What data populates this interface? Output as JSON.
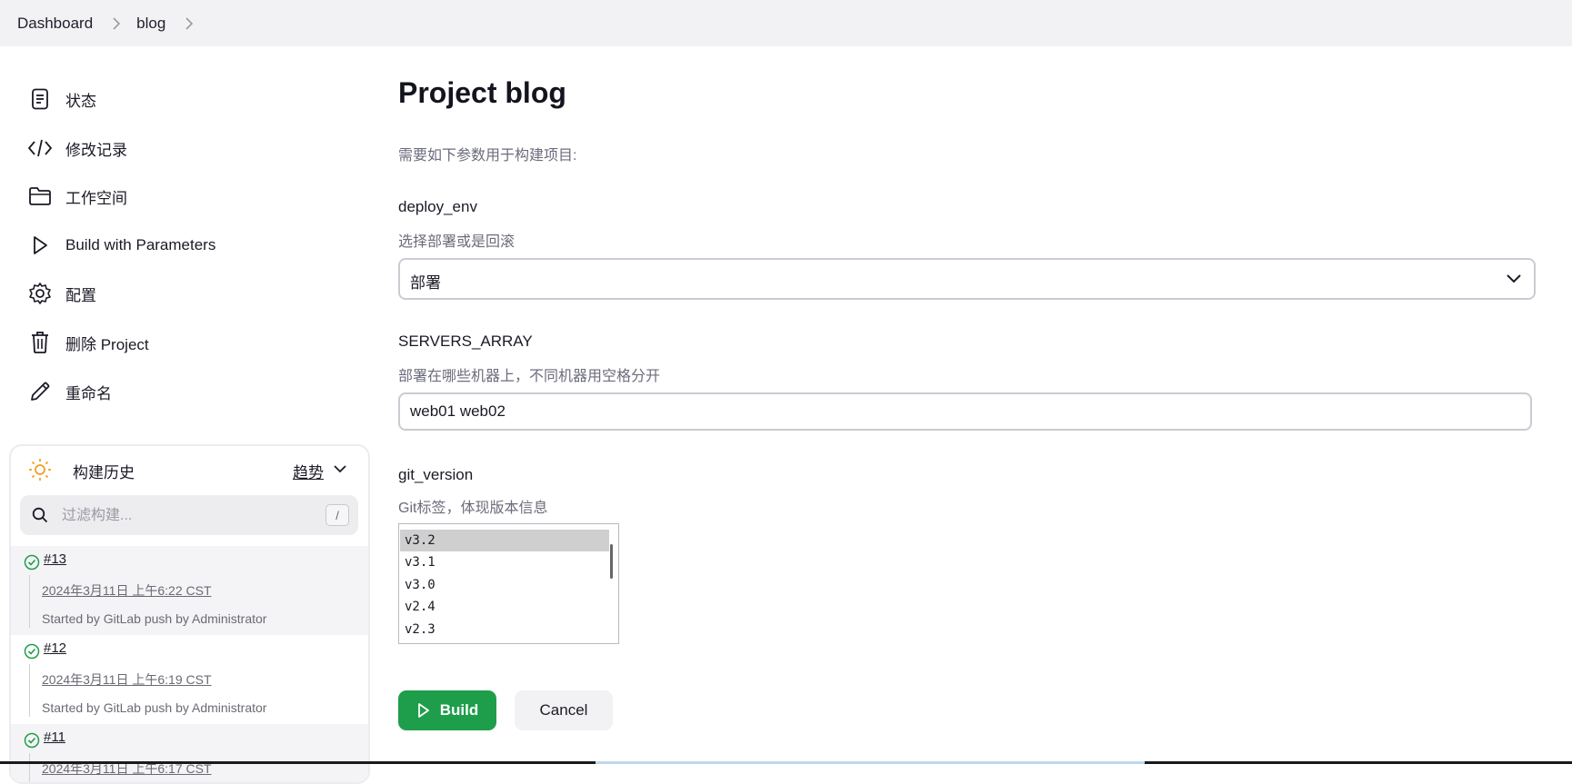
{
  "breadcrumb": {
    "items": [
      "Dashboard",
      "blog"
    ]
  },
  "sidebar": {
    "items": [
      {
        "label": "状态",
        "icon": "status-icon"
      },
      {
        "label": "修改记录",
        "icon": "code-icon"
      },
      {
        "label": "工作空间",
        "icon": "folder-icon"
      },
      {
        "label": "Build with Parameters",
        "icon": "play-icon"
      },
      {
        "label": "配置",
        "icon": "gear-icon"
      },
      {
        "label": "删除 Project",
        "icon": "trash-icon"
      },
      {
        "label": "重命名",
        "icon": "pencil-icon"
      }
    ]
  },
  "history": {
    "title": "构建历史",
    "trend_label": "趋势",
    "search_placeholder": "过滤构建...",
    "shortcut": "/",
    "builds": [
      {
        "number": "#13",
        "date": "2024年3月11日 上午6:22 CST",
        "cause": "Started by GitLab push by Administrator",
        "status": "success"
      },
      {
        "number": "#12",
        "date": "2024年3月11日 上午6:19 CST",
        "cause": "Started by GitLab push by Administrator",
        "status": "success"
      },
      {
        "number": "#11",
        "date": "2024年3月11日 上午6:17 CST",
        "cause": "",
        "status": "success"
      }
    ]
  },
  "main": {
    "title": "Project blog",
    "intro": "需要如下参数用于构建项目:",
    "params": {
      "deploy_env": {
        "name": "deploy_env",
        "description": "选择部署或是回滚",
        "value": "部署"
      },
      "servers": {
        "name": "SERVERS_ARRAY",
        "description": "部署在哪些机器上，不同机器用空格分开",
        "value": "web01 web02"
      },
      "git_version": {
        "name": "git_version",
        "description": "Git标签，体现版本信息",
        "options": [
          "v3.2",
          "v3.1",
          "v3.0",
          "v2.4",
          "v2.3"
        ],
        "selected": "v3.2"
      }
    },
    "build_label": "Build",
    "cancel_label": "Cancel"
  },
  "colors": {
    "accent": "#1e9e4a",
    "status_success": "#1e9e4a",
    "sun": "#f0a020"
  }
}
